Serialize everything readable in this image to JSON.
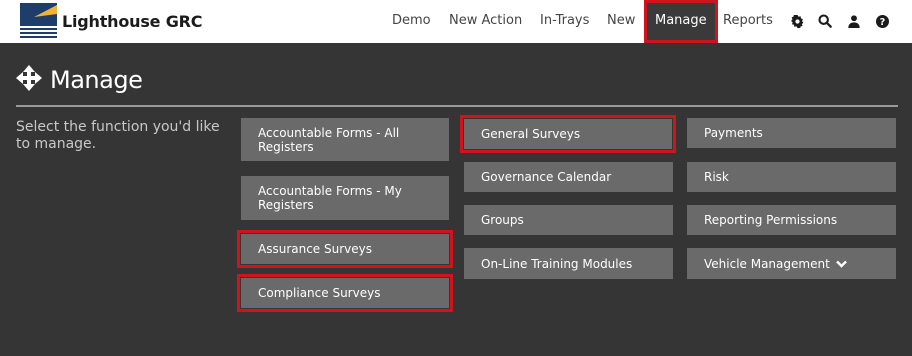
{
  "brand": {
    "name": "Lighthouse GRC"
  },
  "nav": {
    "items": [
      {
        "label": "Demo"
      },
      {
        "label": "New Action"
      },
      {
        "label": "In-Trays"
      },
      {
        "label": "New"
      },
      {
        "label": "Manage",
        "active": true
      },
      {
        "label": "Reports"
      }
    ],
    "icons": [
      "gear-icon",
      "search-icon",
      "user-icon",
      "help-icon"
    ]
  },
  "page": {
    "title": "Manage",
    "title_icon": "move-arrows-icon",
    "intro": "Select the function you'd like to manage."
  },
  "functions": {
    "col1": [
      {
        "label": "Accountable Forms - All Registers"
      },
      {
        "label": "Accountable Forms - My Registers"
      },
      {
        "label": "Assurance Surveys",
        "highlighted": true
      },
      {
        "label": "Compliance Surveys",
        "highlighted": true
      }
    ],
    "col2": [
      {
        "label": "General Surveys",
        "highlighted": true
      },
      {
        "label": "Governance Calendar"
      },
      {
        "label": "Groups"
      },
      {
        "label": "On-Line Training Modules"
      }
    ],
    "col3": [
      {
        "label": "Payments"
      },
      {
        "label": "Risk"
      },
      {
        "label": "Reporting Permissions"
      },
      {
        "label": "Vehicle Management",
        "icon": "chevron-down-icon"
      }
    ]
  },
  "colors": {
    "background": "#353535",
    "button": "#6a6a6a",
    "highlight": "#d0141b",
    "navbar": "#ffffff"
  }
}
